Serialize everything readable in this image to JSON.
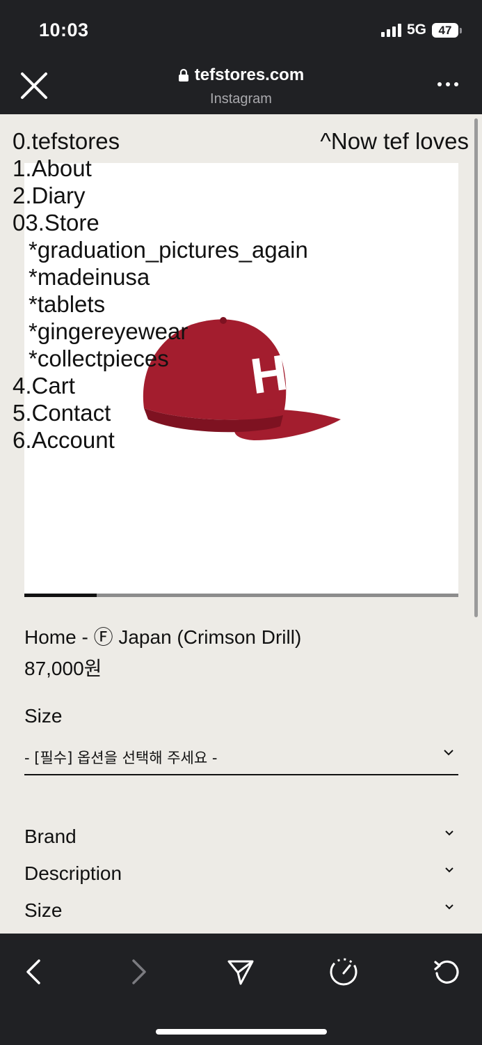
{
  "status": {
    "time": "10:03",
    "network": "5G",
    "battery": "47"
  },
  "browser": {
    "url": "tefstores.com",
    "source": "Instagram"
  },
  "menu": {
    "items": [
      {
        "label": "0.tefstores",
        "sub": false
      },
      {
        "label": "1.About",
        "sub": false
      },
      {
        "label": "2.Diary",
        "sub": false
      },
      {
        "label": "03.Store",
        "sub": false
      },
      {
        "label": "*graduation_pictures_again",
        "sub": true
      },
      {
        "label": "*madeinusa",
        "sub": true
      },
      {
        "label": "*tablets",
        "sub": true
      },
      {
        "label": "*gingereyewear",
        "sub": true
      },
      {
        "label": "*collectpieces",
        "sub": true
      },
      {
        "label": "4.Cart",
        "sub": false
      },
      {
        "label": "5.Contact",
        "sub": false
      },
      {
        "label": "6.Account",
        "sub": false
      }
    ],
    "top_right": "^Now tef loves"
  },
  "product": {
    "image_name": "crimson-cap-with-h-logo",
    "image_letter": "H",
    "image_colors": {
      "cap": "#a31d2e",
      "cap_dark": "#7e1221",
      "letter": "#ffffff"
    },
    "gallery_progress": 0.167,
    "title": "Home - Ⓕ Japan (Crimson Drill)",
    "price": "87,000원",
    "size_label": "Size",
    "select_value": "- [필수] 옵션을 선택해 주세요 -"
  },
  "accordion": [
    {
      "label": "Brand"
    },
    {
      "label": "Description"
    },
    {
      "label": "Size"
    }
  ],
  "toolbar": [
    "back-icon",
    "forward-icon",
    "share-send-icon",
    "speed-dial-icon",
    "reload-icon"
  ]
}
